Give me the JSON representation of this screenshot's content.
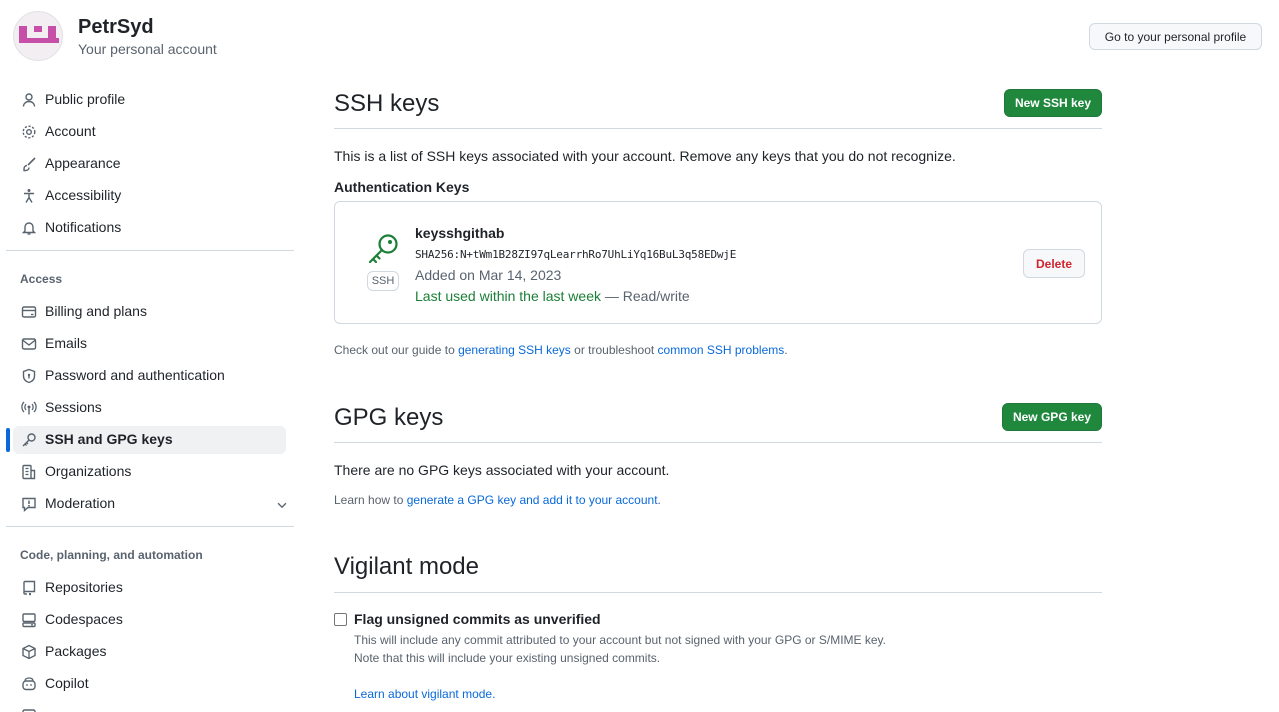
{
  "header": {
    "user_name": "PetrSyd",
    "user_subtitle": "Your personal account",
    "profile_button": "Go to your personal profile"
  },
  "sidebar": {
    "items": [
      {
        "label": "Public profile",
        "icon": "person-icon"
      },
      {
        "label": "Account",
        "icon": "gear-icon"
      },
      {
        "label": "Appearance",
        "icon": "paintbrush-icon"
      },
      {
        "label": "Accessibility",
        "icon": "accessibility-icon"
      },
      {
        "label": "Notifications",
        "icon": "bell-icon"
      }
    ],
    "access_label": "Access",
    "access_items": [
      {
        "label": "Billing and plans",
        "icon": "credit-card-icon"
      },
      {
        "label": "Emails",
        "icon": "mail-icon"
      },
      {
        "label": "Password and authentication",
        "icon": "shield-lock-icon"
      },
      {
        "label": "Sessions",
        "icon": "broadcast-icon"
      },
      {
        "label": "SSH and GPG keys",
        "icon": "key-icon",
        "active": true
      },
      {
        "label": "Organizations",
        "icon": "organization-icon"
      },
      {
        "label": "Moderation",
        "icon": "report-icon"
      }
    ],
    "code_label": "Code, planning, and automation",
    "code_items": [
      {
        "label": "Repositories",
        "icon": "repo-icon"
      },
      {
        "label": "Codespaces",
        "icon": "codespaces-icon"
      },
      {
        "label": "Packages",
        "icon": "package-icon"
      },
      {
        "label": "Copilot",
        "icon": "copilot-icon"
      }
    ]
  },
  "ssh": {
    "title": "SSH keys",
    "new_button": "New SSH key",
    "description": "This is a list of SSH keys associated with your account. Remove any keys that you do not recognize.",
    "auth_heading": "Authentication Keys",
    "key": {
      "title": "keysshgithab",
      "fingerprint": "SHA256:N+tWm1B28ZI97qLearrhRo7UhLiYq16BuL3q58EDwjE",
      "added": "Added on Mar 14, 2023",
      "last_used": "Last used within the last week",
      "access": " — Read/write",
      "badge": "SSH",
      "delete_button": "Delete"
    },
    "guide_prefix": "Check out our guide to ",
    "guide_link1": "generating SSH keys",
    "guide_middle": " or troubleshoot ",
    "guide_link2": "common SSH problems",
    "guide_suffix": "."
  },
  "gpg": {
    "title": "GPG keys",
    "new_button": "New GPG key",
    "empty_text": "There are no GPG keys associated with your account.",
    "learn_prefix": "Learn how to ",
    "learn_link": "generate a GPG key and add it to your account",
    "learn_suffix": "."
  },
  "vigilant": {
    "title": "Vigilant mode",
    "checkbox_label": "Flag unsigned commits as unverified",
    "checked": false,
    "desc1": "This will include any commit attributed to your account but not signed with your GPG or S/MIME key.",
    "desc2": "Note that this will include your existing unsigned commits.",
    "learn_link": "Learn about vigilant mode."
  },
  "colors": {
    "accent": "#0969da",
    "green_button": "#1f883d",
    "danger": "#d1242f",
    "success_text": "#1a7f37",
    "avatar": "#c64fa8"
  }
}
